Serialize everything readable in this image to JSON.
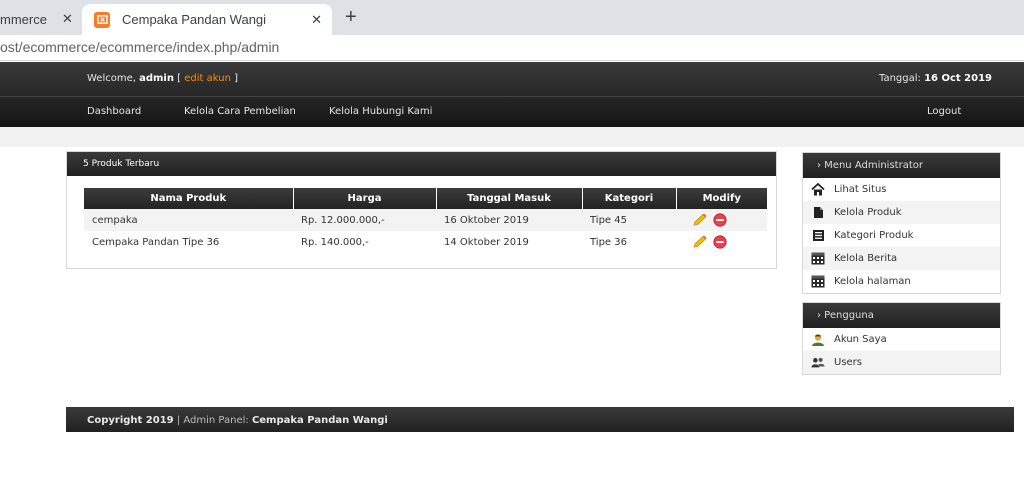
{
  "browser": {
    "tabs": [
      {
        "title": "mmerce",
        "active": false
      },
      {
        "title": "Cempaka Pandan Wangi",
        "active": true
      }
    ],
    "url": "ost/ecommerce/ecommerce/index.php/admin"
  },
  "header": {
    "welcome_prefix": "Welcome, ",
    "user": "admin",
    "bracket_open": " [ ",
    "edit_account": "edit akun",
    "bracket_close": " ]",
    "date_label": "Tanggal: ",
    "date_value": "16 Oct 2019"
  },
  "nav": {
    "items": [
      "Dashboard",
      "Kelola Cara Pembelian",
      "Kelola Hubungi Kami"
    ],
    "logout": "Logout"
  },
  "products_panel": {
    "title": "5 Produk Terbaru",
    "columns": [
      "Nama Produk",
      "Harga",
      "Tanggal Masuk",
      "Kategori",
      "Modify"
    ],
    "rows": [
      [
        "cempaka",
        "Rp. 12.000.000,-",
        "16 Oktober 2019",
        "Tipe 45"
      ],
      [
        "Cempaka Pandan Tipe 36",
        "Rp. 140.000,-",
        "14 Oktober 2019",
        "Tipe 36"
      ]
    ]
  },
  "sidebar": {
    "admin_title": "› Menu Administrator",
    "admin_items": [
      {
        "label": "Lihat Situs",
        "icon": "home-icon"
      },
      {
        "label": "Kelola Produk",
        "icon": "document-icon"
      },
      {
        "label": "Kategori Produk",
        "icon": "list-icon"
      },
      {
        "label": "Kelola Berita",
        "icon": "calendar-icon"
      },
      {
        "label": "Kelola halaman",
        "icon": "calendar-icon"
      }
    ],
    "user_title": "› Pengguna",
    "user_items": [
      {
        "label": "Akun Saya",
        "icon": "user-icon"
      },
      {
        "label": "Users",
        "icon": "users-icon"
      }
    ]
  },
  "footer": {
    "copyright": "Copyright 2019",
    "separator": " | Admin Panel: ",
    "site": "Cempaka Pandan Wangi"
  },
  "colors": {
    "accent_orange": "#ff8a00",
    "header_dark": "#262626"
  }
}
